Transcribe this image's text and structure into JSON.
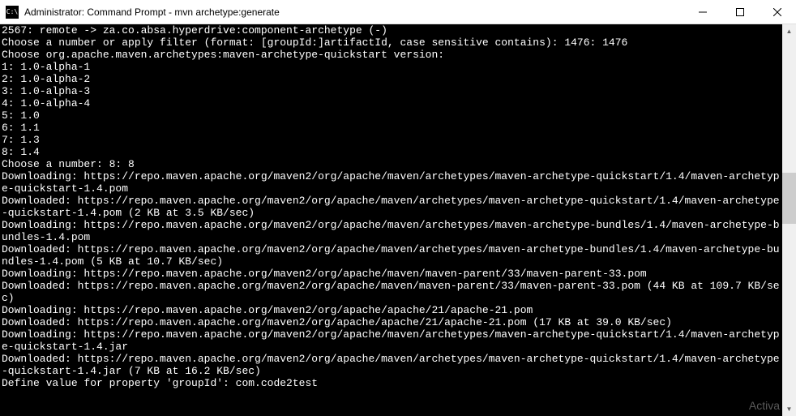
{
  "window": {
    "icon_text": "C:\\",
    "title": "Administrator: Command Prompt - mvn  archetype:generate"
  },
  "terminal": {
    "lines": [
      "2567: remote -> za.co.absa.hyperdrive:component-archetype (-)",
      "Choose a number or apply filter (format: [groupId:]artifactId, case sensitive contains): 1476: 1476",
      "Choose org.apache.maven.archetypes:maven-archetype-quickstart version:",
      "1: 1.0-alpha-1",
      "2: 1.0-alpha-2",
      "3: 1.0-alpha-3",
      "4: 1.0-alpha-4",
      "5: 1.0",
      "6: 1.1",
      "7: 1.3",
      "8: 1.4",
      "Choose a number: 8: 8",
      "Downloading: https://repo.maven.apache.org/maven2/org/apache/maven/archetypes/maven-archetype-quickstart/1.4/maven-archetype-quickstart-1.4.pom",
      "Downloaded: https://repo.maven.apache.org/maven2/org/apache/maven/archetypes/maven-archetype-quickstart/1.4/maven-archetype-quickstart-1.4.pom (2 KB at 3.5 KB/sec)",
      "Downloading: https://repo.maven.apache.org/maven2/org/apache/maven/archetypes/maven-archetype-bundles/1.4/maven-archetype-bundles-1.4.pom",
      "Downloaded: https://repo.maven.apache.org/maven2/org/apache/maven/archetypes/maven-archetype-bundles/1.4/maven-archetype-bundles-1.4.pom (5 KB at 10.7 KB/sec)",
      "Downloading: https://repo.maven.apache.org/maven2/org/apache/maven/maven-parent/33/maven-parent-33.pom",
      "Downloaded: https://repo.maven.apache.org/maven2/org/apache/maven/maven-parent/33/maven-parent-33.pom (44 KB at 109.7 KB/sec)",
      "Downloading: https://repo.maven.apache.org/maven2/org/apache/apache/21/apache-21.pom",
      "Downloaded: https://repo.maven.apache.org/maven2/org/apache/apache/21/apache-21.pom (17 KB at 39.0 KB/sec)",
      "Downloading: https://repo.maven.apache.org/maven2/org/apache/maven/archetypes/maven-archetype-quickstart/1.4/maven-archetype-quickstart-1.4.jar",
      "Downloaded: https://repo.maven.apache.org/maven2/org/apache/maven/archetypes/maven-archetype-quickstart/1.4/maven-archetype-quickstart-1.4.jar (7 KB at 16.2 KB/sec)",
      "Define value for property 'groupId': com.code2test"
    ]
  },
  "watermark": "Activa"
}
